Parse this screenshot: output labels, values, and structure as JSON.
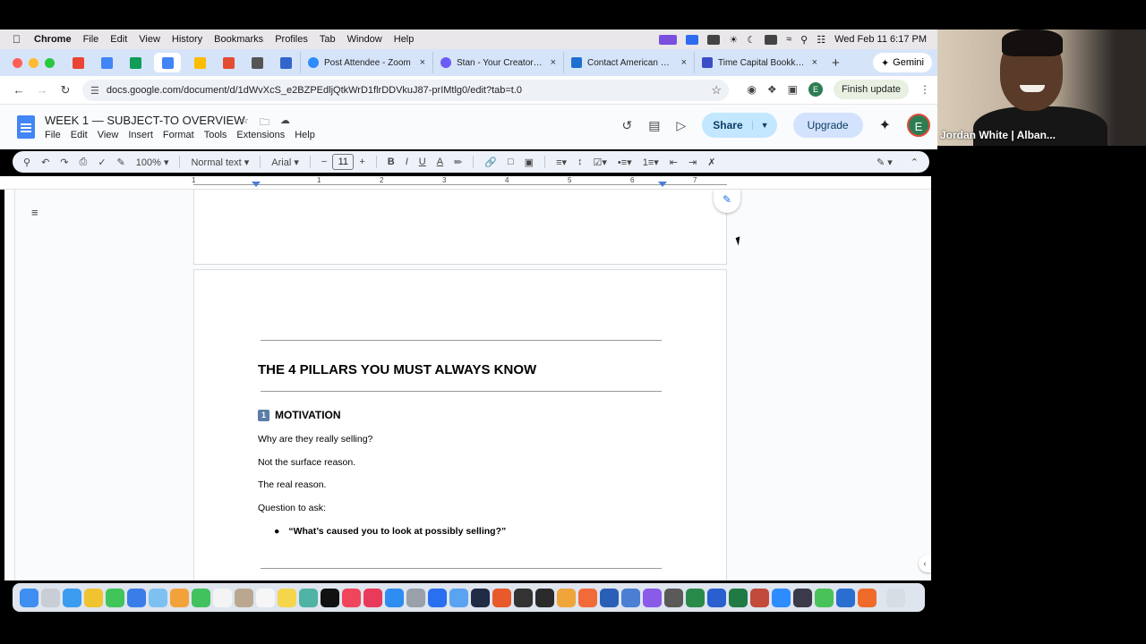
{
  "menubar": {
    "app": "Chrome",
    "items": [
      "File",
      "Edit",
      "View",
      "History",
      "Bookmarks",
      "Profiles",
      "Tab",
      "Window",
      "Help"
    ],
    "clock": "Wed Feb 11  6:17 PM"
  },
  "tabs": [
    {
      "title": "Post Attendee - Zoom",
      "color": "#2d8cff"
    },
    {
      "title": "Stan - Your Creator Sto",
      "color": "#6b5cf6"
    },
    {
      "title": "Contact American Expr",
      "color": "#1f6fd1"
    },
    {
      "title": "Time Capital Bookkeep",
      "color": "#3a4fc7"
    }
  ],
  "gemini_label": "Gemini",
  "address": {
    "url": "docs.google.com/document/d/1dWvXcS_e2BZPEdljQtkWrD1flrDDVkuJ87-prIMtlg0/edit?tab=t.0",
    "finish_update": "Finish update",
    "profile_initial": "E"
  },
  "doc": {
    "title": "WEEK 1 — SUBJECT-TO OVERVIEW",
    "menus": [
      "File",
      "Edit",
      "View",
      "Insert",
      "Format",
      "Tools",
      "Extensions",
      "Help"
    ],
    "share_label": "Share",
    "upgrade_label": "Upgrade",
    "avatar_initial": "E"
  },
  "toolbar": {
    "zoom": "100%",
    "style": "Normal text",
    "font": "Arial",
    "size": "11",
    "bold": "B",
    "italic": "I",
    "underline": "U",
    "text_color": "A"
  },
  "ruler": {
    "numbers": [
      "1",
      "1",
      "2",
      "3",
      "4",
      "5",
      "6",
      "7"
    ]
  },
  "content": {
    "heading": "THE 4 PILLARS YOU MUST ALWAYS KNOW",
    "section_number": "1",
    "section_title": "MOTIVATION",
    "lines": [
      "Why are they really selling?",
      "Not the surface reason.",
      "The real reason.",
      "Question to ask:"
    ],
    "bullet": "“What’s caused you to look at possibly selling?”"
  },
  "video": {
    "participant_name": "Jordan White | Alban..."
  }
}
